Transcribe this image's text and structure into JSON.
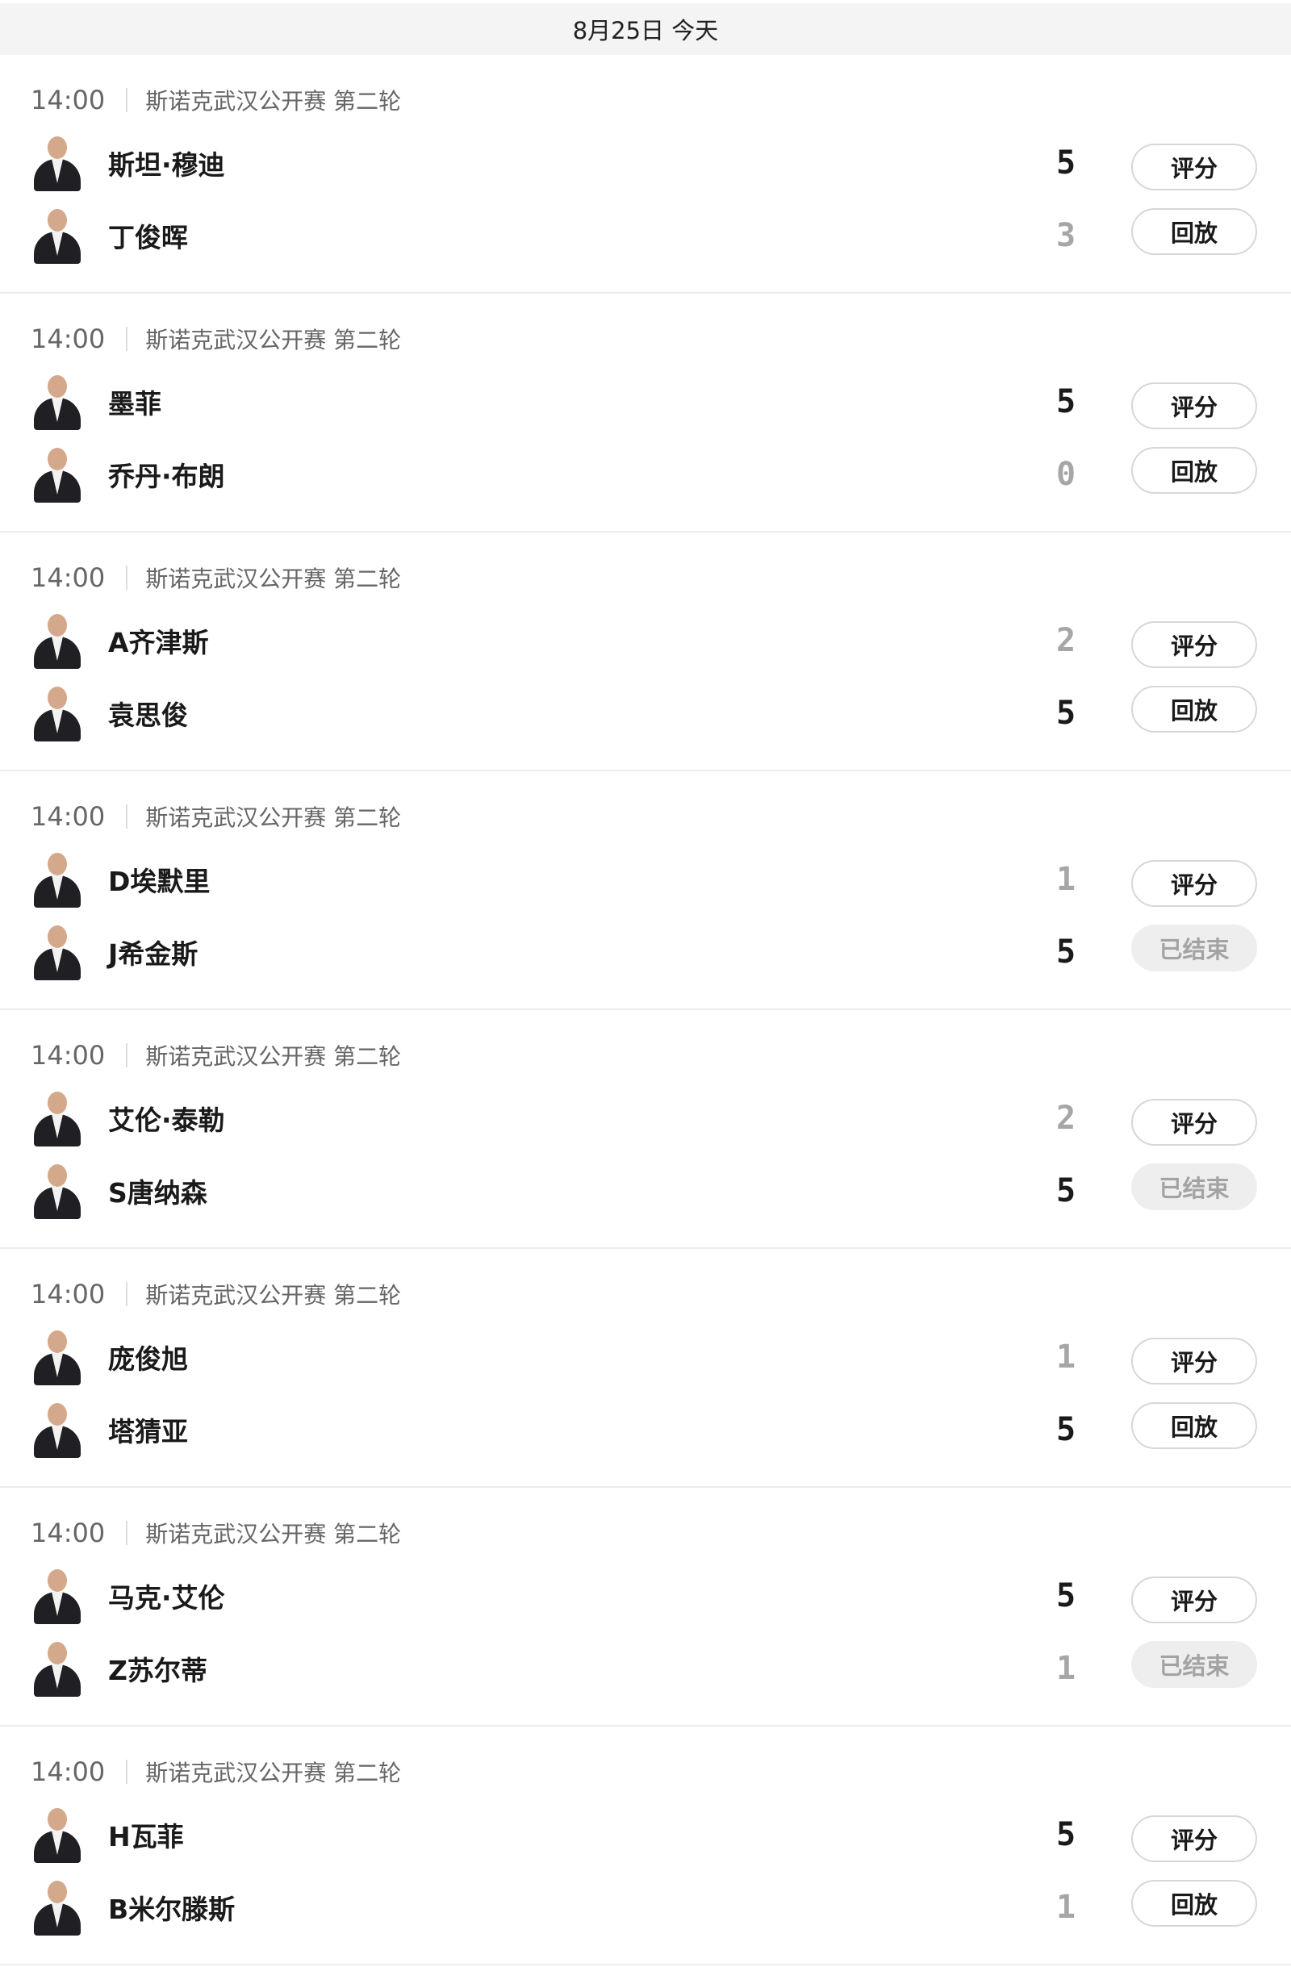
{
  "date_header": "8月25日 今天",
  "buttons": {
    "rate": "评分",
    "replay": "回放",
    "ended": "已结束"
  },
  "matches": [
    {
      "time": "14:00",
      "event": "斯诺克武汉公开赛 第二轮",
      "players": [
        {
          "name": "斯坦·穆迪",
          "score": "5"
        },
        {
          "name": "丁俊晖",
          "score": "3"
        }
      ],
      "action": "回放"
    },
    {
      "time": "14:00",
      "event": "斯诺克武汉公开赛 第二轮",
      "players": [
        {
          "name": "墨菲",
          "score": "5"
        },
        {
          "name": "乔丹·布朗",
          "score": "0"
        }
      ],
      "action": "回放"
    },
    {
      "time": "14:00",
      "event": "斯诺克武汉公开赛 第二轮",
      "players": [
        {
          "name": "A齐津斯",
          "score": "2"
        },
        {
          "name": "袁思俊",
          "score": "5"
        }
      ],
      "action": "回放"
    },
    {
      "time": "14:00",
      "event": "斯诺克武汉公开赛 第二轮",
      "players": [
        {
          "name": "D埃默里",
          "score": "1"
        },
        {
          "name": "J希金斯",
          "score": "5"
        }
      ],
      "action": "已结束"
    },
    {
      "time": "14:00",
      "event": "斯诺克武汉公开赛 第二轮",
      "players": [
        {
          "name": "艾伦·泰勒",
          "score": "2"
        },
        {
          "name": "S唐纳森",
          "score": "5"
        }
      ],
      "action": "已结束"
    },
    {
      "time": "14:00",
      "event": "斯诺克武汉公开赛 第二轮",
      "players": [
        {
          "name": "庞俊旭",
          "score": "1"
        },
        {
          "name": "塔猜亚",
          "score": "5"
        }
      ],
      "action": "回放"
    },
    {
      "time": "14:00",
      "event": "斯诺克武汉公开赛 第二轮",
      "players": [
        {
          "name": "马克·艾伦",
          "score": "5"
        },
        {
          "name": "Z苏尔蒂",
          "score": "1"
        }
      ],
      "action": "已结束"
    },
    {
      "time": "14:00",
      "event": "斯诺克武汉公开赛 第二轮",
      "players": [
        {
          "name": "H瓦菲",
          "score": "5"
        },
        {
          "name": "B米尔滕斯",
          "score": "1"
        }
      ],
      "action": "回放"
    }
  ]
}
